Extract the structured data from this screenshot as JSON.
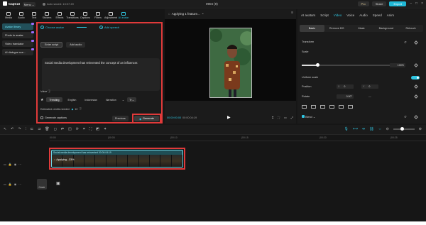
{
  "app": {
    "logo": "CapCut",
    "menu_label": "Menu",
    "autosave": "Auto saved: 13:07:49",
    "project_title": "0904 (9)",
    "pro_label": "Pro",
    "share_label": "Share",
    "export_label": "Export"
  },
  "toolbar": {
    "items": [
      "Media",
      "Audio",
      "Text",
      "Stickers",
      "Effects",
      "Transitions",
      "Captions",
      "Filters",
      "Adjustment",
      "AI avatar"
    ]
  },
  "left_nav": {
    "items": [
      "Avatar library",
      "Photo to avatar",
      "Video translator",
      "AI dialogue sce..."
    ]
  },
  "avatar_panel": {
    "step1": "Choose avatar",
    "step2": "Add speech",
    "tab_script": "Enter script",
    "tab_audio": "Add audio",
    "script_text": "Social media development has reinvented the concept of an influencer.",
    "voice_label": "Voice",
    "voices": [
      "Trending",
      "English",
      "Indonesian",
      "Narration"
    ],
    "voice_more": "Tr",
    "credits": "Estimated credits needed:",
    "credits_value": "10",
    "gen_captions": "Generate captions",
    "previous": "Previous",
    "generate": "Generate"
  },
  "player": {
    "title": "Applying 1 feature...",
    "timecode": "00:00:00:00",
    "duration": "00:00:04:19"
  },
  "props": {
    "tabs": [
      "AI avatars",
      "Script",
      "Video",
      "Voice",
      "Audio",
      "Speed",
      "Anim"
    ],
    "sub_tabs": [
      "Basic",
      "Remove BG",
      "Mask",
      "Background",
      "Retouch"
    ],
    "transform": "Transform",
    "scale": "Scale",
    "scale_value": "100%",
    "uniform_scale": "Uniform scale",
    "position": "Position",
    "pos_x_label": "X",
    "pos_x": "0",
    "pos_y_label": "Y",
    "pos_y": "0",
    "rotate": "Rotate",
    "rotate_value": "0.00°",
    "blend": "Blend"
  },
  "timeline": {
    "ruler": [
      "00:00",
      "|00:05",
      "|00:10",
      "|00:15",
      "|00:20",
      "|00:25"
    ],
    "clip_label": "Social media development has reinvented  00:00:04:19",
    "clip_status": "Applying...33%",
    "cover_label": "Cover"
  }
}
